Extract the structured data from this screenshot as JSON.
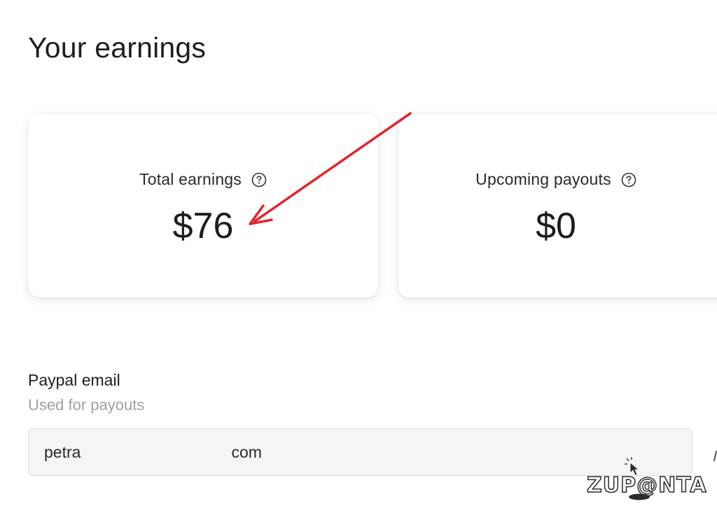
{
  "page": {
    "title": "Your earnings"
  },
  "cards": {
    "total": {
      "label": "Total earnings",
      "value": "$76",
      "icon": "help-icon"
    },
    "upcoming": {
      "label": "Upcoming payouts",
      "value": "$0",
      "icon": "help-icon"
    }
  },
  "paypal": {
    "label": "Paypal email",
    "hint": "Used for payouts",
    "value_part_1": "petra",
    "value_part_2": "com"
  },
  "annotation": {
    "arrow_color": "#e0252b"
  },
  "watermark": {
    "text": "ZUP@NTA",
    "icon": "cursor-click-icon"
  }
}
